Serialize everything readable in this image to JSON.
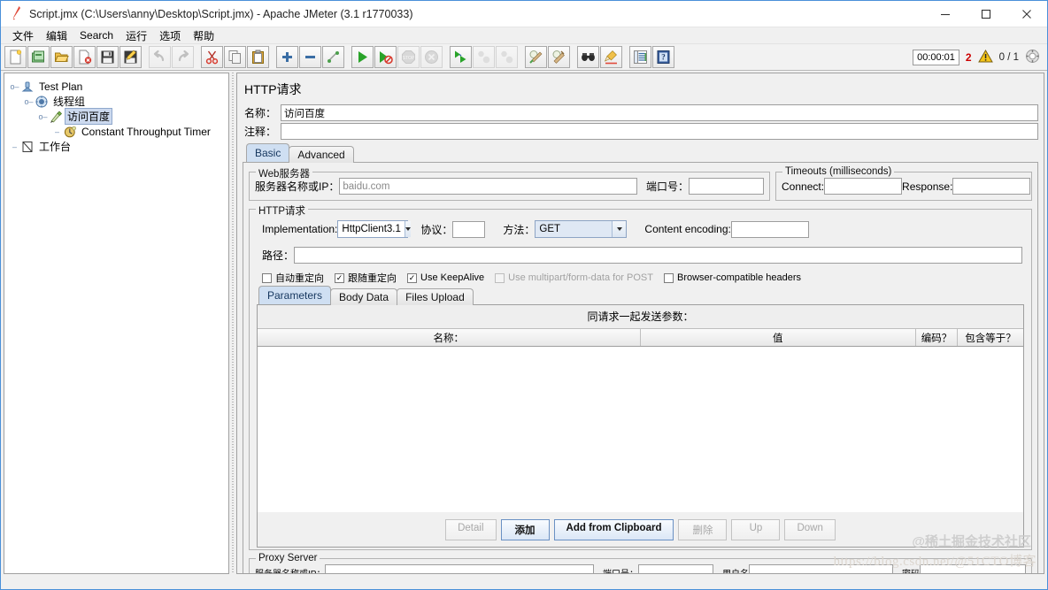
{
  "window": {
    "title": "Script.jmx (C:\\Users\\anny\\Desktop\\Script.jmx) - Apache JMeter (3.1 r1770033)",
    "app_icon": "jmeter-feather-icon",
    "minimize": "—",
    "maximize": "□",
    "close": "✕"
  },
  "menu": {
    "items": [
      {
        "label": "文件",
        "name": "menu-file"
      },
      {
        "label": "编辑",
        "name": "menu-edit"
      },
      {
        "label": "Search",
        "name": "menu-search"
      },
      {
        "label": "运行",
        "name": "menu-run"
      },
      {
        "label": "选项",
        "name": "menu-options"
      },
      {
        "label": "帮助",
        "name": "menu-help"
      }
    ]
  },
  "toolbar": {
    "buttons": [
      {
        "name": "new-icon",
        "tip": "New"
      },
      {
        "name": "templates-icon",
        "tip": "Templates"
      },
      {
        "name": "open-icon",
        "tip": "Open"
      },
      {
        "name": "close-file-icon",
        "tip": "Close"
      },
      {
        "name": "save-icon",
        "tip": "Save"
      },
      {
        "name": "save-as-icon",
        "tip": "Save As"
      },
      {
        "name": "undo-icon",
        "tip": "Undo"
      },
      {
        "name": "redo-icon",
        "tip": "Redo"
      },
      {
        "name": "cut-icon",
        "tip": "Cut"
      },
      {
        "name": "copy-icon",
        "tip": "Copy"
      },
      {
        "name": "paste-icon",
        "tip": "Paste"
      },
      {
        "name": "expand-all-icon",
        "tip": "Expand All"
      },
      {
        "name": "collapse-all-icon",
        "tip": "Collapse All"
      },
      {
        "name": "toggle-icon",
        "tip": "Toggle"
      },
      {
        "name": "start-icon",
        "tip": "Start"
      },
      {
        "name": "start-no-pauses-icon",
        "tip": "Start no pauses"
      },
      {
        "name": "stop-icon",
        "tip": "Stop"
      },
      {
        "name": "shutdown-icon",
        "tip": "Shutdown"
      },
      {
        "name": "remote-start-all-icon",
        "tip": "Remote Start All"
      },
      {
        "name": "remote-stop-all-icon",
        "tip": "Remote Stop All"
      },
      {
        "name": "remote-shutdown-all-icon",
        "tip": "Remote Shutdown All"
      },
      {
        "name": "clear-icon",
        "tip": "Clear"
      },
      {
        "name": "clear-all-icon",
        "tip": "Clear All"
      },
      {
        "name": "search-icon",
        "tip": "Search"
      },
      {
        "name": "search-reset-icon",
        "tip": "Reset Search"
      },
      {
        "name": "function-helper-icon",
        "tip": "Function Helper Dialog"
      },
      {
        "name": "help-icon",
        "tip": "Help"
      }
    ],
    "status": {
      "timer": "00:00:01",
      "warning_count": "2",
      "warning_icon": "warning-triangle-icon",
      "threads": "0 / 1",
      "threads_icon": "thread-gauge-icon"
    }
  },
  "tree": {
    "nodes": [
      {
        "label": "Test Plan",
        "icon": "test-plan-icon",
        "depth": 0,
        "selected": false,
        "handle": "expanded"
      },
      {
        "label": "线程组",
        "icon": "thread-group-icon",
        "depth": 1,
        "selected": false,
        "handle": "expanded"
      },
      {
        "label": "访问百度",
        "icon": "http-sampler-icon",
        "depth": 2,
        "selected": true,
        "handle": "expanded"
      },
      {
        "label": "Constant Throughput Timer",
        "icon": "timer-icon",
        "depth": 3,
        "selected": false,
        "handle": "leaf"
      },
      {
        "label": "工作台",
        "icon": "workbench-icon",
        "depth": 0,
        "selected": false,
        "handle": "leaf"
      }
    ]
  },
  "main": {
    "panel_title": "HTTP请求",
    "name_label": "名称：",
    "name_value": "访问百度",
    "comment_label": "注释：",
    "comment_value": "",
    "tabs": [
      {
        "label": "Basic",
        "name": "tab-basic",
        "active": true
      },
      {
        "label": "Advanced",
        "name": "tab-advanced",
        "active": false
      }
    ],
    "web_server": {
      "title": "Web服务器",
      "server_label": "服务器名称或IP：",
      "server_value": "baidu.com",
      "port_label": "端口号：",
      "port_value": ""
    },
    "timeouts": {
      "title": "Timeouts (milliseconds)",
      "connect_label": "Connect:",
      "connect_value": "",
      "response_label": "Response:",
      "response_value": ""
    },
    "http_request": {
      "title": "HTTP请求",
      "implementation_label": "Implementation:",
      "implementation_value": "HttpClient3.1",
      "protocol_label": "协议：",
      "protocol_value": "",
      "method_label": "方法：",
      "method_value": "GET",
      "content_encoding_label": "Content encoding:",
      "content_encoding_value": "",
      "path_label": "路径：",
      "path_value": "",
      "checkboxes": [
        {
          "label": "自动重定向",
          "checked": false,
          "disabled": false,
          "name": "checkbox-auto-redirect"
        },
        {
          "label": "跟随重定向",
          "checked": true,
          "disabled": false,
          "name": "checkbox-follow-redirect"
        },
        {
          "label": "Use KeepAlive",
          "checked": true,
          "disabled": false,
          "name": "checkbox-use-keepalive"
        },
        {
          "label": "Use multipart/form-data for POST",
          "checked": false,
          "disabled": true,
          "name": "checkbox-use-multipart"
        },
        {
          "label": "Browser-compatible headers",
          "checked": false,
          "disabled": false,
          "name": "checkbox-browser-compatible-headers"
        }
      ]
    },
    "param_tabs": [
      {
        "label": "Parameters",
        "name": "tab-parameters",
        "active": true
      },
      {
        "label": "Body Data",
        "name": "tab-body-data",
        "active": false
      },
      {
        "label": "Files Upload",
        "name": "tab-files-upload",
        "active": false
      }
    ],
    "param_table": {
      "caption": "同请求一起发送参数：",
      "columns": [
        "名称：",
        "值",
        "编码？",
        "包含等于？"
      ],
      "rows": []
    },
    "param_buttons": [
      {
        "label": "Detail",
        "name": "detail-button",
        "disabled": true,
        "primary": false
      },
      {
        "label": "添加",
        "name": "add-button",
        "disabled": false,
        "primary": true
      },
      {
        "label": "Add from Clipboard",
        "name": "add-from-clipboard-button",
        "disabled": false,
        "primary": true
      },
      {
        "label": "删除",
        "name": "delete-button",
        "disabled": true,
        "primary": false
      },
      {
        "label": "Up",
        "name": "up-button",
        "disabled": true,
        "primary": false
      },
      {
        "label": "Down",
        "name": "down-button",
        "disabled": true,
        "primary": false
      }
    ],
    "proxy_server": {
      "title": "Proxy Server",
      "server_label": "服务器名称或IP：",
      "server_value": "",
      "port_label": "端口号：",
      "port_value": "",
      "user_label": "用户名",
      "user_value": "",
      "password_label": "密码",
      "password_value": ""
    }
  },
  "watermarks": {
    "primary": "@稀土掘金技术社区",
    "secondary": "https://blog.csdn.net/@51CTO博客"
  },
  "colors": {
    "accent": "#4a90d9",
    "selection": "#ccd9ee",
    "tab_active": "#cfdff2",
    "warning": "#cc0000",
    "panel": "#f0f0f0"
  }
}
